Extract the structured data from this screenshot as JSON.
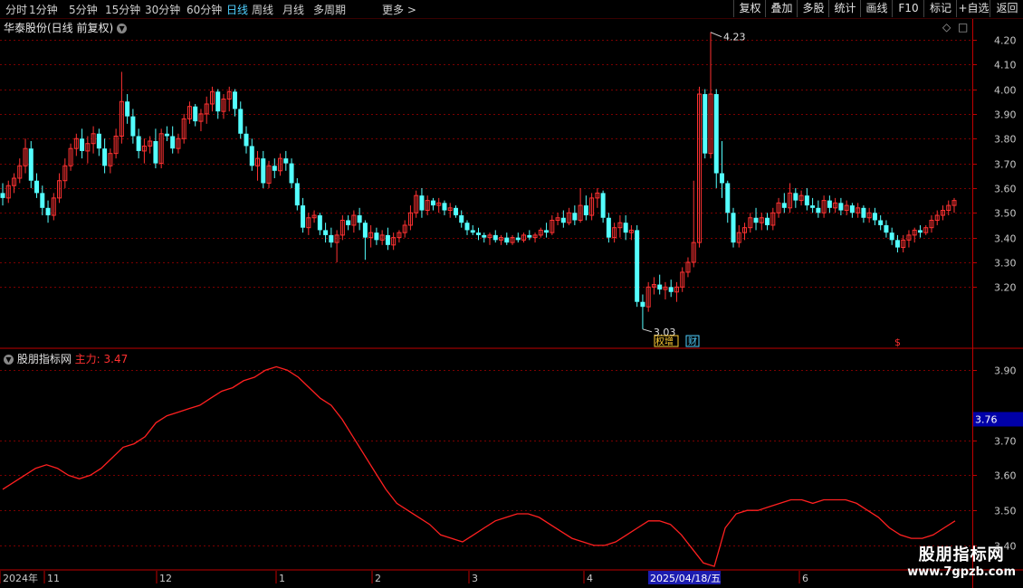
{
  "toolbar": {
    "periods": [
      "分时",
      "1分钟",
      "5分钟",
      "15分钟",
      "30分钟",
      "60分钟",
      "日线",
      "周线",
      "月线",
      "多周期",
      "更多 >"
    ],
    "active_period": "日线",
    "right_buttons": [
      "复权",
      "叠加",
      "多股",
      "统计",
      "画线",
      "F10",
      "标记",
      "+自选",
      "返回"
    ]
  },
  "main_panel": {
    "title": "华泰股份(日线 前复权)",
    "high_label": "4.23",
    "low_label": "3.03",
    "event_tag_1": "权增",
    "event_tag_2": "财",
    "event_tag_3": "$",
    "y_ticks": [
      "4.20",
      "4.10",
      "4.00",
      "3.90",
      "3.80",
      "3.70",
      "3.60",
      "3.50",
      "3.40",
      "3.30",
      "3.20"
    ]
  },
  "indicator_panel": {
    "name": "股朋指标网",
    "line_label": "主力:",
    "line_value": "3.47",
    "current_value_box": "3.76",
    "y_ticks": [
      "3.90",
      "3.70",
      "3.60",
      "3.50",
      "3.40"
    ]
  },
  "date_axis": {
    "labels": [
      "2024年",
      "11",
      "12",
      "1",
      "2",
      "3",
      "4",
      "2025/04/18/五",
      "6"
    ]
  },
  "watermark": {
    "title": "股朋指标网",
    "url": "www.7gpzb.com"
  },
  "colors": {
    "up": "#ff3232",
    "down": "#54ffff",
    "grid": "#7a0000",
    "axis": "#c00000",
    "line": "#ff2020"
  },
  "chart_data": [
    {
      "type": "candlestick",
      "title": "华泰股份(日线 前复权)",
      "ylim": [
        3.0,
        4.28
      ],
      "y_ticks": [
        4.2,
        4.1,
        4.0,
        3.9,
        3.8,
        3.7,
        3.6,
        3.5,
        3.4,
        3.3,
        3.2
      ],
      "annotations": [
        {
          "text": "4.23",
          "value": 4.23
        },
        {
          "text": "3.03",
          "value": 3.03
        }
      ],
      "ohlc": [
        [
          3.58,
          3.62,
          3.53,
          3.56
        ],
        [
          3.56,
          3.63,
          3.54,
          3.61
        ],
        [
          3.61,
          3.66,
          3.58,
          3.64
        ],
        [
          3.64,
          3.72,
          3.62,
          3.69
        ],
        [
          3.69,
          3.8,
          3.66,
          3.76
        ],
        [
          3.76,
          3.79,
          3.6,
          3.63
        ],
        [
          3.63,
          3.66,
          3.56,
          3.58
        ],
        [
          3.58,
          3.61,
          3.49,
          3.52
        ],
        [
          3.52,
          3.55,
          3.46,
          3.49
        ],
        [
          3.49,
          3.58,
          3.47,
          3.56
        ],
        [
          3.56,
          3.66,
          3.54,
          3.63
        ],
        [
          3.63,
          3.72,
          3.6,
          3.69
        ],
        [
          3.69,
          3.78,
          3.67,
          3.76
        ],
        [
          3.76,
          3.82,
          3.73,
          3.8
        ],
        [
          3.8,
          3.84,
          3.72,
          3.75
        ],
        [
          3.75,
          3.81,
          3.7,
          3.78
        ],
        [
          3.78,
          3.85,
          3.74,
          3.82
        ],
        [
          3.82,
          3.84,
          3.73,
          3.76
        ],
        [
          3.76,
          3.8,
          3.66,
          3.69
        ],
        [
          3.69,
          3.76,
          3.66,
          3.74
        ],
        [
          3.74,
          3.84,
          3.72,
          3.81
        ],
        [
          3.81,
          4.07,
          3.78,
          3.95
        ],
        [
          3.95,
          3.98,
          3.86,
          3.89
        ],
        [
          3.89,
          3.92,
          3.78,
          3.81
        ],
        [
          3.81,
          3.84,
          3.72,
          3.75
        ],
        [
          3.75,
          3.8,
          3.7,
          3.77
        ],
        [
          3.77,
          3.81,
          3.74,
          3.79
        ],
        [
          3.79,
          3.84,
          3.68,
          3.7
        ],
        [
          3.7,
          3.84,
          3.68,
          3.82
        ],
        [
          3.82,
          3.85,
          3.79,
          3.81
        ],
        [
          3.81,
          3.85,
          3.74,
          3.76
        ],
        [
          3.76,
          3.82,
          3.74,
          3.8
        ],
        [
          3.8,
          3.9,
          3.78,
          3.88
        ],
        [
          3.88,
          3.95,
          3.86,
          3.93
        ],
        [
          3.93,
          3.94,
          3.85,
          3.87
        ],
        [
          3.87,
          3.92,
          3.83,
          3.9
        ],
        [
          3.9,
          3.97,
          3.86,
          3.94
        ],
        [
          3.94,
          4.01,
          3.91,
          3.99
        ],
        [
          3.99,
          4.0,
          3.88,
          3.91
        ],
        [
          3.91,
          3.98,
          3.88,
          3.96
        ],
        [
          3.96,
          4.01,
          3.91,
          3.99
        ],
        [
          3.99,
          4.0,
          3.89,
          3.92
        ],
        [
          3.92,
          3.95,
          3.8,
          3.82
        ],
        [
          3.82,
          3.85,
          3.74,
          3.77
        ],
        [
          3.77,
          3.8,
          3.67,
          3.69
        ],
        [
          3.69,
          3.75,
          3.63,
          3.72
        ],
        [
          3.72,
          3.75,
          3.6,
          3.62
        ],
        [
          3.62,
          3.71,
          3.6,
          3.69
        ],
        [
          3.69,
          3.72,
          3.64,
          3.67
        ],
        [
          3.67,
          3.74,
          3.65,
          3.72
        ],
        [
          3.72,
          3.75,
          3.67,
          3.7
        ],
        [
          3.7,
          3.72,
          3.6,
          3.62
        ],
        [
          3.62,
          3.64,
          3.51,
          3.53
        ],
        [
          3.53,
          3.56,
          3.42,
          3.44
        ],
        [
          3.44,
          3.5,
          3.41,
          3.48
        ],
        [
          3.48,
          3.51,
          3.46,
          3.49
        ],
        [
          3.49,
          3.5,
          3.41,
          3.43
        ],
        [
          3.43,
          3.46,
          3.38,
          3.41
        ],
        [
          3.41,
          3.44,
          3.36,
          3.38
        ],
        [
          3.38,
          3.43,
          3.3,
          3.41
        ],
        [
          3.41,
          3.49,
          3.39,
          3.47
        ],
        [
          3.47,
          3.49,
          3.43,
          3.45
        ],
        [
          3.45,
          3.51,
          3.42,
          3.49
        ],
        [
          3.49,
          3.52,
          3.43,
          3.46
        ],
        [
          3.46,
          3.47,
          3.31,
          3.4
        ],
        [
          3.4,
          3.45,
          3.36,
          3.42
        ],
        [
          3.42,
          3.44,
          3.37,
          3.39
        ],
        [
          3.39,
          3.43,
          3.37,
          3.41
        ],
        [
          3.41,
          3.44,
          3.35,
          3.37
        ],
        [
          3.37,
          3.42,
          3.35,
          3.4
        ],
        [
          3.4,
          3.43,
          3.38,
          3.42
        ],
        [
          3.42,
          3.47,
          3.4,
          3.45
        ],
        [
          3.45,
          3.53,
          3.43,
          3.5
        ],
        [
          3.5,
          3.59,
          3.48,
          3.57
        ],
        [
          3.57,
          3.6,
          3.48,
          3.51
        ],
        [
          3.51,
          3.57,
          3.49,
          3.55
        ],
        [
          3.55,
          3.56,
          3.51,
          3.53
        ],
        [
          3.53,
          3.56,
          3.5,
          3.54
        ],
        [
          3.54,
          3.55,
          3.49,
          3.51
        ],
        [
          3.51,
          3.54,
          3.48,
          3.52
        ],
        [
          3.52,
          3.53,
          3.48,
          3.49
        ],
        [
          3.49,
          3.51,
          3.44,
          3.46
        ],
        [
          3.46,
          3.47,
          3.41,
          3.43
        ],
        [
          3.43,
          3.45,
          3.41,
          3.42
        ],
        [
          3.42,
          3.44,
          3.39,
          3.41
        ],
        [
          3.41,
          3.42,
          3.38,
          3.4
        ],
        [
          3.4,
          3.42,
          3.37,
          3.41
        ],
        [
          3.41,
          3.43,
          3.38,
          3.39
        ],
        [
          3.39,
          3.41,
          3.37,
          3.4
        ],
        [
          3.4,
          3.42,
          3.37,
          3.38
        ],
        [
          3.38,
          3.41,
          3.37,
          3.4
        ],
        [
          3.4,
          3.42,
          3.38,
          3.39
        ],
        [
          3.39,
          3.42,
          3.38,
          3.41
        ],
        [
          3.41,
          3.43,
          3.39,
          3.4
        ],
        [
          3.4,
          3.42,
          3.38,
          3.41
        ],
        [
          3.41,
          3.44,
          3.4,
          3.43
        ],
        [
          3.43,
          3.46,
          3.4,
          3.42
        ],
        [
          3.42,
          3.49,
          3.41,
          3.47
        ],
        [
          3.47,
          3.5,
          3.45,
          3.48
        ],
        [
          3.48,
          3.51,
          3.44,
          3.46
        ],
        [
          3.46,
          3.52,
          3.45,
          3.5
        ],
        [
          3.5,
          3.53,
          3.45,
          3.47
        ],
        [
          3.47,
          3.6,
          3.46,
          3.53
        ],
        [
          3.53,
          3.57,
          3.47,
          3.49
        ],
        [
          3.49,
          3.58,
          3.47,
          3.56
        ],
        [
          3.56,
          3.6,
          3.52,
          3.58
        ],
        [
          3.58,
          3.59,
          3.46,
          3.48
        ],
        [
          3.48,
          3.5,
          3.38,
          3.4
        ],
        [
          3.4,
          3.46,
          3.38,
          3.44
        ],
        [
          3.44,
          3.49,
          3.4,
          3.46
        ],
        [
          3.46,
          3.49,
          3.39,
          3.42
        ],
        [
          3.42,
          3.45,
          3.39,
          3.43
        ],
        [
          3.43,
          3.45,
          3.12,
          3.14
        ],
        [
          3.14,
          3.17,
          3.03,
          3.12
        ],
        [
          3.12,
          3.22,
          3.1,
          3.2
        ],
        [
          3.2,
          3.24,
          3.17,
          3.21
        ],
        [
          3.21,
          3.25,
          3.17,
          3.19
        ],
        [
          3.19,
          3.22,
          3.15,
          3.2
        ],
        [
          3.2,
          3.23,
          3.16,
          3.18
        ],
        [
          3.18,
          3.22,
          3.14,
          3.2
        ],
        [
          3.2,
          3.28,
          3.18,
          3.26
        ],
        [
          3.26,
          3.32,
          3.24,
          3.3
        ],
        [
          3.3,
          3.63,
          3.28,
          3.38
        ],
        [
          3.38,
          4.01,
          3.36,
          3.98
        ],
        [
          3.98,
          4.0,
          3.72,
          3.74
        ],
        [
          3.74,
          4.23,
          3.72,
          3.98
        ],
        [
          3.98,
          4.0,
          3.6,
          3.66
        ],
        [
          3.66,
          3.79,
          3.56,
          3.62
        ],
        [
          3.62,
          3.63,
          3.46,
          3.5
        ],
        [
          3.5,
          3.52,
          3.36,
          3.38
        ],
        [
          3.38,
          3.45,
          3.36,
          3.42
        ],
        [
          3.42,
          3.46,
          3.39,
          3.44
        ],
        [
          3.44,
          3.5,
          3.42,
          3.48
        ],
        [
          3.48,
          3.52,
          3.43,
          3.46
        ],
        [
          3.46,
          3.5,
          3.43,
          3.48
        ],
        [
          3.48,
          3.5,
          3.43,
          3.45
        ],
        [
          3.45,
          3.52,
          3.43,
          3.5
        ],
        [
          3.5,
          3.56,
          3.48,
          3.54
        ],
        [
          3.54,
          3.58,
          3.5,
          3.52
        ],
        [
          3.52,
          3.62,
          3.5,
          3.58
        ],
        [
          3.58,
          3.6,
          3.52,
          3.55
        ],
        [
          3.55,
          3.59,
          3.53,
          3.57
        ],
        [
          3.57,
          3.6,
          3.51,
          3.53
        ],
        [
          3.53,
          3.56,
          3.5,
          3.52
        ],
        [
          3.52,
          3.55,
          3.48,
          3.5
        ],
        [
          3.5,
          3.57,
          3.48,
          3.55
        ],
        [
          3.55,
          3.57,
          3.5,
          3.52
        ],
        [
          3.52,
          3.56,
          3.5,
          3.54
        ],
        [
          3.54,
          3.56,
          3.49,
          3.51
        ],
        [
          3.51,
          3.55,
          3.49,
          3.53
        ],
        [
          3.53,
          3.54,
          3.48,
          3.5
        ],
        [
          3.5,
          3.54,
          3.48,
          3.52
        ],
        [
          3.52,
          3.53,
          3.46,
          3.48
        ],
        [
          3.48,
          3.52,
          3.46,
          3.5
        ],
        [
          3.5,
          3.52,
          3.45,
          3.47
        ],
        [
          3.47,
          3.49,
          3.43,
          3.45
        ],
        [
          3.45,
          3.47,
          3.4,
          3.42
        ],
        [
          3.42,
          3.44,
          3.37,
          3.39
        ],
        [
          3.39,
          3.41,
          3.34,
          3.36
        ],
        [
          3.36,
          3.41,
          3.34,
          3.39
        ],
        [
          3.39,
          3.43,
          3.36,
          3.41
        ],
        [
          3.41,
          3.44,
          3.38,
          3.43
        ],
        [
          3.43,
          3.45,
          3.4,
          3.42
        ],
        [
          3.42,
          3.45,
          3.41,
          3.44
        ],
        [
          3.44,
          3.49,
          3.42,
          3.47
        ],
        [
          3.47,
          3.51,
          3.45,
          3.49
        ],
        [
          3.49,
          3.53,
          3.47,
          3.51
        ],
        [
          3.51,
          3.55,
          3.49,
          3.53
        ],
        [
          3.53,
          3.56,
          3.5,
          3.55
        ]
      ]
    },
    {
      "type": "line",
      "name": "主力",
      "ylim": [
        3.33,
        3.96
      ],
      "y_ticks": [
        3.9,
        3.7,
        3.6,
        3.5,
        3.4
      ],
      "values": [
        3.56,
        3.58,
        3.6,
        3.62,
        3.63,
        3.62,
        3.6,
        3.59,
        3.6,
        3.62,
        3.65,
        3.68,
        3.69,
        3.71,
        3.75,
        3.77,
        3.78,
        3.79,
        3.8,
        3.82,
        3.84,
        3.85,
        3.87,
        3.88,
        3.9,
        3.91,
        3.9,
        3.88,
        3.85,
        3.82,
        3.8,
        3.76,
        3.71,
        3.66,
        3.61,
        3.56,
        3.52,
        3.5,
        3.48,
        3.46,
        3.43,
        3.42,
        3.41,
        3.43,
        3.45,
        3.47,
        3.48,
        3.49,
        3.49,
        3.48,
        3.46,
        3.44,
        3.42,
        3.41,
        3.4,
        3.4,
        3.41,
        3.43,
        3.45,
        3.47,
        3.47,
        3.46,
        3.43,
        3.39,
        3.35,
        3.34,
        3.45,
        3.49,
        3.5,
        3.5,
        3.51,
        3.52,
        3.53,
        3.53,
        3.52,
        3.53,
        3.53,
        3.53,
        3.52,
        3.5,
        3.48,
        3.45,
        3.43,
        3.42,
        3.42,
        3.43,
        3.45,
        3.47
      ]
    }
  ]
}
